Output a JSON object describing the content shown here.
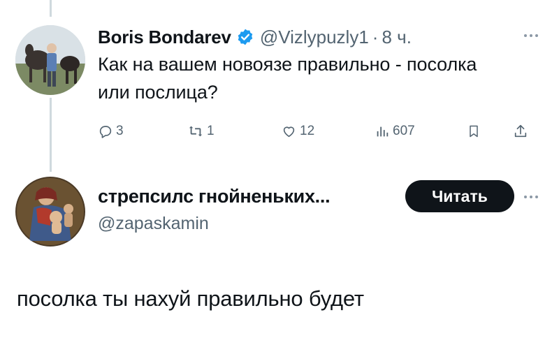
{
  "tweet": {
    "author_name": "Boris Bondarev",
    "author_handle": "@Vizlypuzly1",
    "time": "8 ч.",
    "text": "Как на вашем новоязе правильно - посолка или послица?",
    "stats": {
      "replies": "3",
      "reposts": "1",
      "likes": "12",
      "views": "607"
    }
  },
  "suggested_account": {
    "name": "стрепсилс гнойненьких...",
    "handle": "@zapaskamin",
    "read_button_label": "Читать"
  },
  "reply_text": "посолка ты нахуй правильно будет",
  "icons": {
    "verified": "verified-badge-icon",
    "reply": "reply-icon",
    "repost": "repost-icon",
    "like": "heart-icon",
    "views": "views-icon",
    "bookmark": "bookmark-icon",
    "share": "share-icon",
    "more": "more-icon"
  },
  "colors": {
    "text_primary": "#0f1419",
    "text_secondary": "#536471",
    "verified_blue": "#1d9bf0",
    "button_dark": "#0f1419",
    "thread_line": "#cfd9de"
  }
}
